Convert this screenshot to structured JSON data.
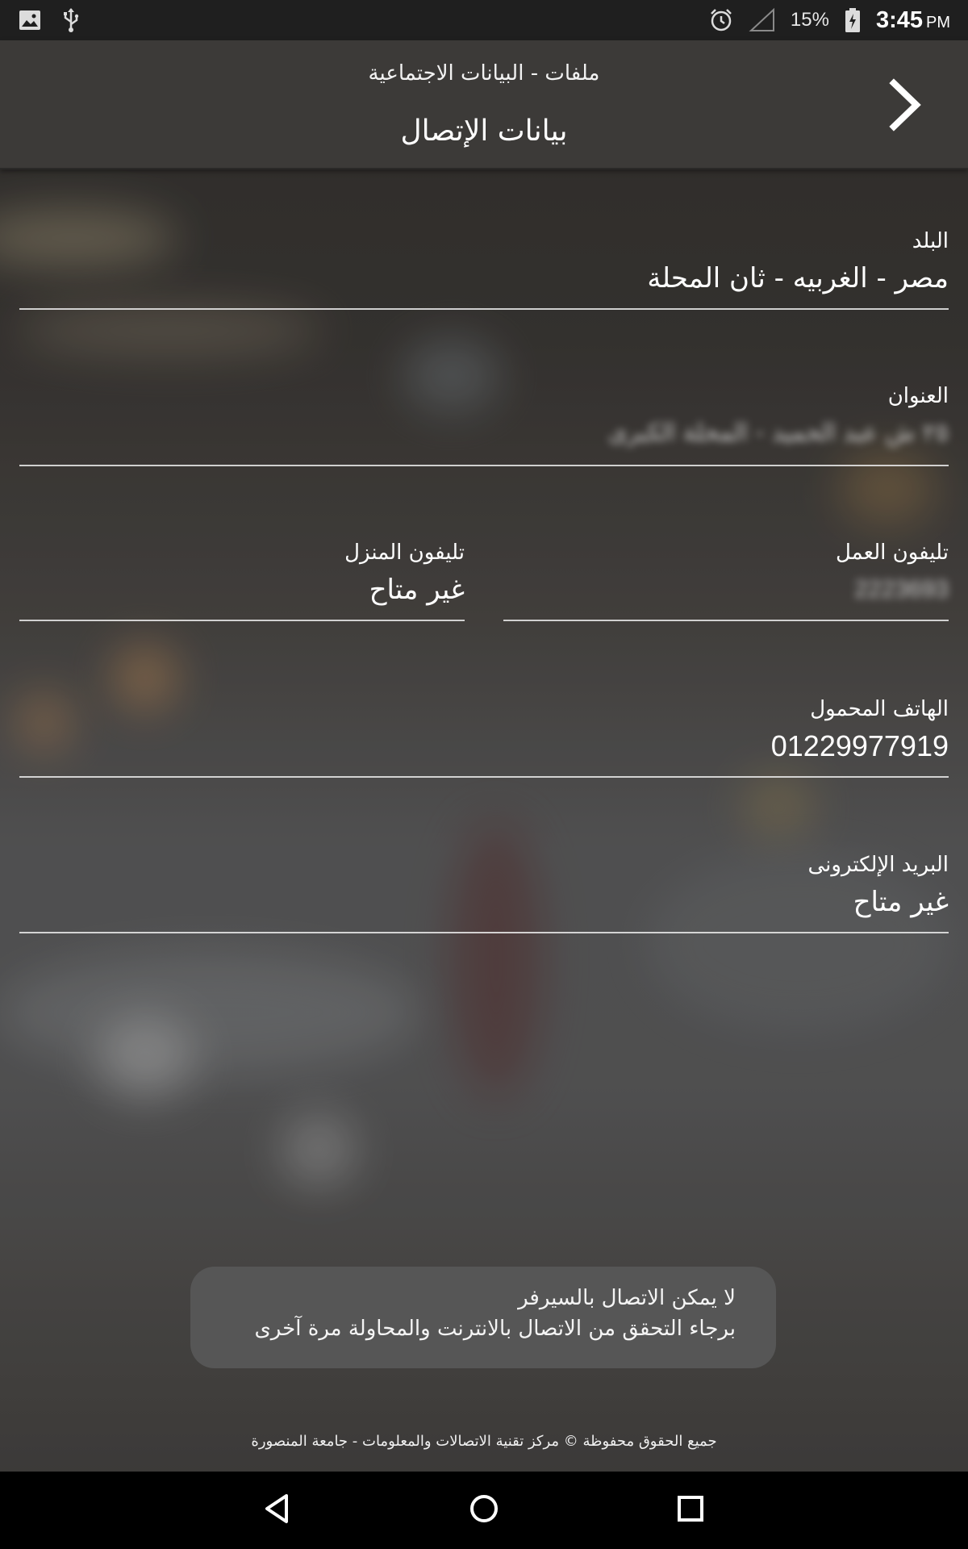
{
  "status_bar": {
    "battery": "15%",
    "time": "3:45",
    "ampm": "PM"
  },
  "header": {
    "subtitle": "ملفات - البيانات الاجتماعية",
    "title": "بيانات الإتصال"
  },
  "fields": {
    "country": {
      "label": "البلد",
      "value": "مصر - الغربيه - ثان المحلة"
    },
    "address": {
      "label": "العنوان",
      "value": "٢٥ ش عبد الحميد - المحلة الكبرى"
    },
    "work_phone": {
      "label": "تليفون العمل",
      "value": "2223693"
    },
    "home_phone": {
      "label": "تليفون المنزل",
      "value": "غير متاح"
    },
    "mobile": {
      "label": "الهاتف المحمول",
      "value": "01229977919"
    },
    "email": {
      "label": "البريد الإلكترونى",
      "value": "غير متاح"
    }
  },
  "toast": {
    "line1": "لا يمكن الاتصال بالسيرفر",
    "line2": "برجاء التحقق من الاتصال بالانترنت والمحاولة مرة آخرى"
  },
  "footer": {
    "text": "جميع الحقوق محفوظة © مركز تقنية الاتصالات والمعلومات - جامعة المنصورة"
  }
}
